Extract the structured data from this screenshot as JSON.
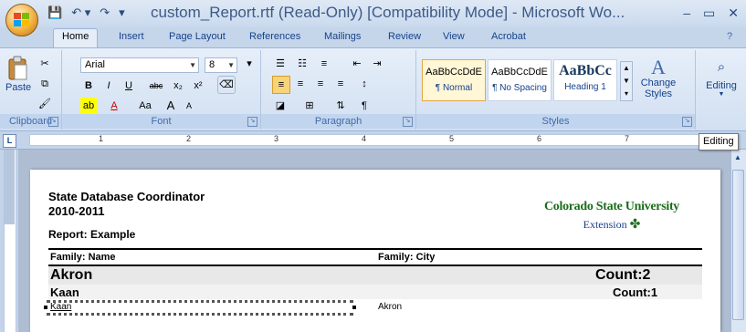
{
  "window": {
    "title": "custom_Report.rtf (Read-Only) [Compatibility Mode] - Microsoft Wo...",
    "quick_access": [
      "💾",
      "↶ ▾",
      "↷",
      "▾"
    ],
    "controls": [
      "–",
      "▭",
      "✕"
    ]
  },
  "tabs": [
    "Home",
    "Insert",
    "Page Layout",
    "References",
    "Mailings",
    "Review",
    "View",
    "Acrobat"
  ],
  "help_icon": "?",
  "ribbon": {
    "clipboard": {
      "label": "Clipboard",
      "paste": "Paste"
    },
    "font": {
      "label": "Font",
      "family": "Arial",
      "size": "8",
      "buttons": [
        "B",
        "I",
        "U",
        "abc",
        "x₂",
        "x²",
        "Aa",
        "A",
        "A"
      ]
    },
    "paragraph": {
      "label": "Paragraph"
    },
    "styles": {
      "label": "Styles",
      "items": [
        {
          "sample": "AaBbCcDdE",
          "name": "¶ Normal"
        },
        {
          "sample": "AaBbCcDdE",
          "name": "¶ No Spacing"
        },
        {
          "sample": "AaBbCc",
          "name": "Heading 1"
        }
      ],
      "change_styles": "Change Styles"
    },
    "editing": {
      "label": "Editing"
    }
  },
  "ruler": {
    "numbers": [
      "1",
      "2",
      "3",
      "4",
      "5",
      "6",
      "7"
    ],
    "corner": "L"
  },
  "tooltip": "Editing",
  "document": {
    "header_title": "State Database Coordinator",
    "year": "2010-2011",
    "report": "Report: Example",
    "logo_line1": "Colorado State University",
    "logo_line2": "Extension",
    "col1": "Family: Name",
    "col2": "Family: City",
    "group1": {
      "name": "Akron",
      "count": "Count:2"
    },
    "group2": {
      "name": "Kaan",
      "count": "Count:1"
    },
    "row": {
      "name": "Kaan",
      "city": "Akron"
    }
  },
  "colors": {
    "accent": "#15428b",
    "logo_green": "#1a6e1a",
    "logo_blue": "#1a3f8a"
  }
}
